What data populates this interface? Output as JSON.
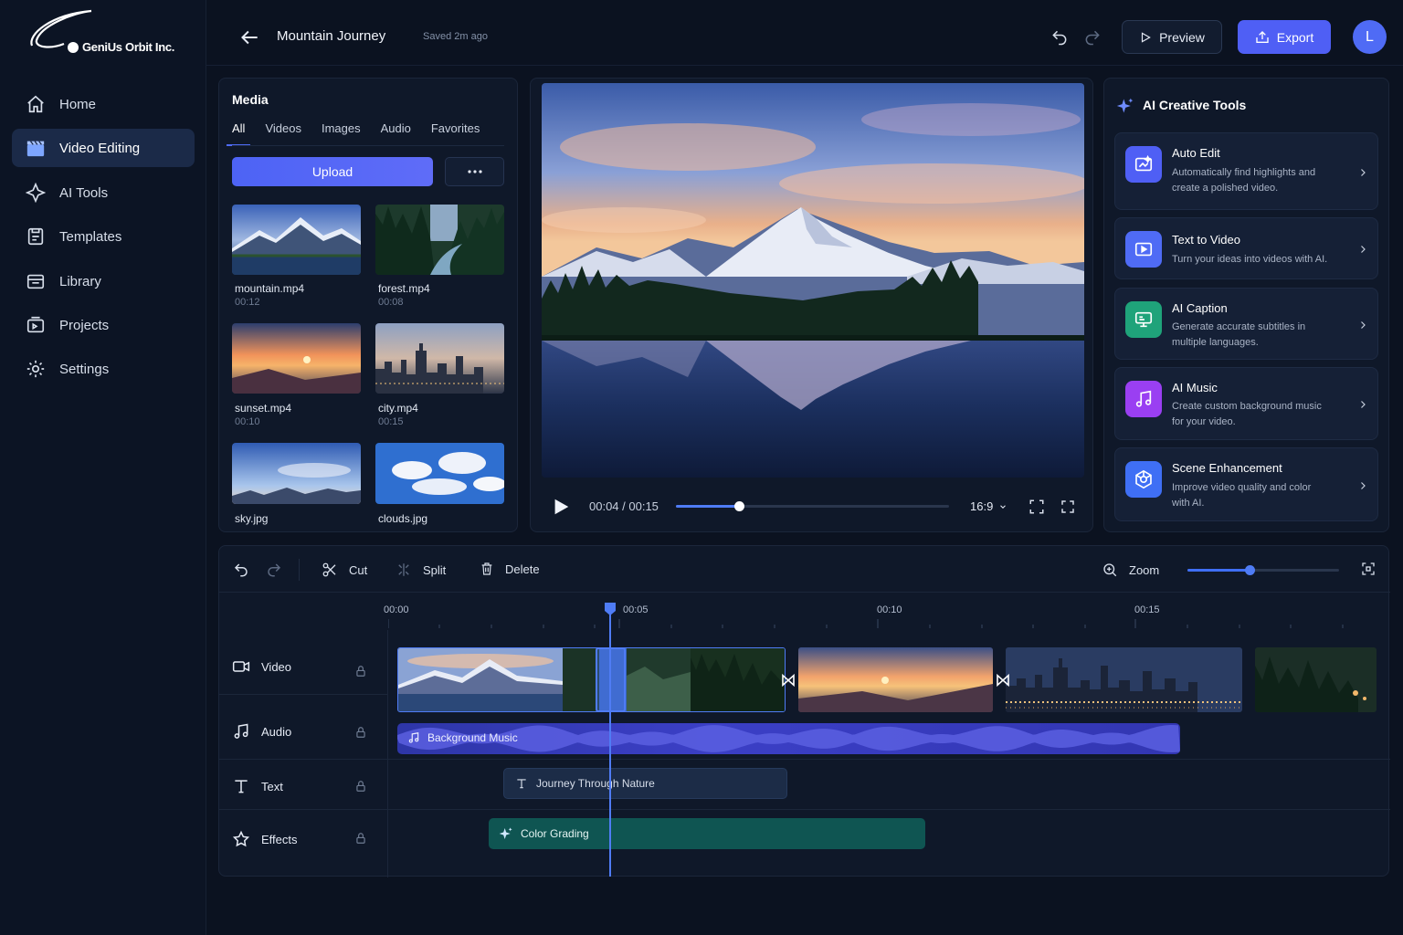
{
  "brand": {
    "logo_text": "GeniUs Orbit Inc."
  },
  "nav": [
    {
      "label": "Home",
      "icon": "home-icon"
    },
    {
      "label": "Video Editing",
      "icon": "clapperboard-icon",
      "active": true
    },
    {
      "label": "AI Tools",
      "icon": "sparkle-icon"
    },
    {
      "label": "Templates",
      "icon": "template-icon"
    },
    {
      "label": "Library",
      "icon": "library-icon"
    },
    {
      "label": "Projects",
      "icon": "projects-icon"
    },
    {
      "label": "Settings",
      "icon": "gear-icon"
    }
  ],
  "header": {
    "title": "Mountain Journey",
    "saved": "Saved 2m ago",
    "preview_label": "Preview",
    "export_label": "Export",
    "avatar_initial": "L"
  },
  "media": {
    "title": "Media",
    "tabs": [
      "All",
      "Videos",
      "Images",
      "Audio",
      "Favorites"
    ],
    "active_tab": "All",
    "upload_label": "Upload",
    "items": [
      {
        "name": "mountain.mp4",
        "duration": "00:12"
      },
      {
        "name": "forest.mp4",
        "duration": "00:08"
      },
      {
        "name": "sunset.mp4",
        "duration": "00:10"
      },
      {
        "name": "city.mp4",
        "duration": "00:15"
      },
      {
        "name": "sky.jpg",
        "duration": ""
      },
      {
        "name": "clouds.jpg",
        "duration": ""
      }
    ]
  },
  "player": {
    "time": "00:04 / 00:15",
    "progress": 0.23,
    "aspect": "16:9"
  },
  "ai_tools": {
    "title": "AI Creative Tools",
    "items": [
      {
        "name": "Auto Edit",
        "desc": "Automatically find highlights and create a polished video.",
        "color": "#4f5ff5"
      },
      {
        "name": "Text to Video",
        "desc": "Turn your ideas into videos with AI.",
        "color": "#4f6bf5"
      },
      {
        "name": "AI Caption",
        "desc": "Generate accurate subtitles in multiple languages.",
        "color": "#1fa37a"
      },
      {
        "name": "AI Music",
        "desc": "Create custom background music for your video.",
        "color": "#9a3ff2"
      },
      {
        "name": "Scene Enhancement",
        "desc": "Improve video quality and color with AI.",
        "color": "#3f6ff5"
      }
    ]
  },
  "timeline": {
    "tools": {
      "cut": "Cut",
      "split": "Split",
      "delete": "Delete",
      "zoom": "Zoom"
    },
    "zoom_level": 0.41,
    "ticks": [
      "00:00",
      "00:05",
      "00:10",
      "00:15"
    ],
    "tracks": [
      "Video",
      "Audio",
      "Text",
      "Effects"
    ],
    "audio_clip": "Background Music",
    "text_clip": "Journey Through Nature",
    "effect_clip": "Color Grading"
  }
}
